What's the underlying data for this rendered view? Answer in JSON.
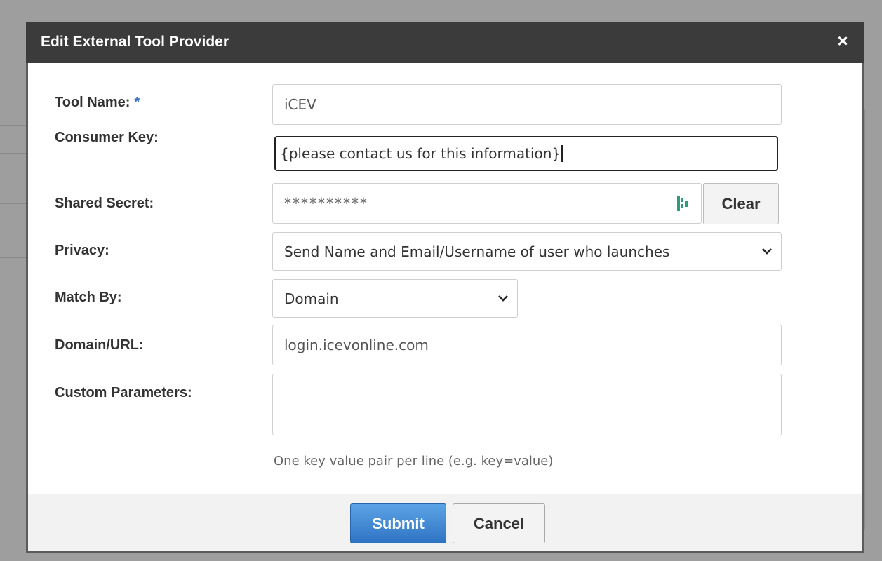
{
  "dialog": {
    "title": "Edit External Tool Provider",
    "close_glyph": "×"
  },
  "form": {
    "tool_name": {
      "label": "Tool Name:",
      "required_mark": "*",
      "value": "iCEV"
    },
    "consumer_key": {
      "label": "Consumer Key:",
      "value": "{please contact us for this information}"
    },
    "shared_secret": {
      "label": "Shared Secret:",
      "value": "**********",
      "clear_label": "Clear",
      "icon": "password-manager-icon"
    },
    "privacy": {
      "label": "Privacy:",
      "selected": "Send Name and Email/Username of user who launches"
    },
    "match_by": {
      "label": "Match By:",
      "selected": "Domain"
    },
    "domain_url": {
      "label": "Domain/URL:",
      "value": "login.icevonline.com"
    },
    "custom_parameters": {
      "label": "Custom Parameters:",
      "value": "",
      "hint": "One key value pair per line (e.g. key=value)"
    }
  },
  "footer": {
    "submit_label": "Submit",
    "cancel_label": "Cancel",
    "submit_color": "#2f74c3"
  }
}
